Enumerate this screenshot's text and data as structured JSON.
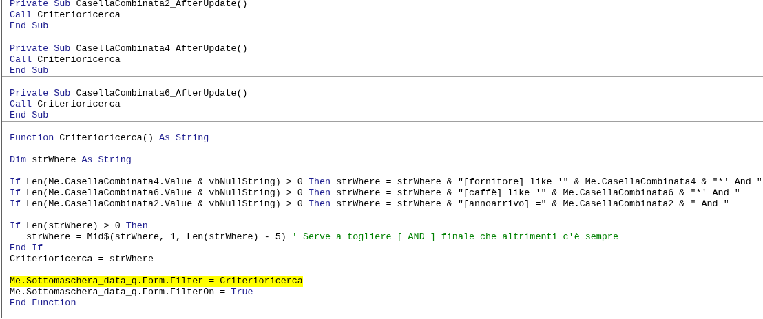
{
  "procedures": [
    {
      "lines": [
        {
          "kind": "code",
          "highlighted": false,
          "tokens": [
            {
              "kind": "keyword",
              "text": "Private Sub"
            },
            {
              "kind": "text",
              "text": " CasellaCombinata2_AfterUpdate()"
            }
          ]
        },
        {
          "kind": "code",
          "highlighted": false,
          "tokens": [
            {
              "kind": "keyword",
              "text": "Call"
            },
            {
              "kind": "text",
              "text": " Criterioricerca"
            }
          ]
        },
        {
          "kind": "code",
          "highlighted": false,
          "tokens": [
            {
              "kind": "keyword",
              "text": "End Sub"
            }
          ]
        }
      ]
    },
    {
      "lines": [
        {
          "kind": "blank"
        },
        {
          "kind": "code",
          "highlighted": false,
          "tokens": [
            {
              "kind": "keyword",
              "text": "Private Sub"
            },
            {
              "kind": "text",
              "text": " CasellaCombinata4_AfterUpdate()"
            }
          ]
        },
        {
          "kind": "code",
          "highlighted": false,
          "tokens": [
            {
              "kind": "keyword",
              "text": "Call"
            },
            {
              "kind": "text",
              "text": " Criterioricerca"
            }
          ]
        },
        {
          "kind": "code",
          "highlighted": false,
          "tokens": [
            {
              "kind": "keyword",
              "text": "End Sub"
            }
          ]
        }
      ]
    },
    {
      "lines": [
        {
          "kind": "blank"
        },
        {
          "kind": "code",
          "highlighted": false,
          "tokens": [
            {
              "kind": "keyword",
              "text": "Private Sub"
            },
            {
              "kind": "text",
              "text": " CasellaCombinata6_AfterUpdate()"
            }
          ]
        },
        {
          "kind": "code",
          "highlighted": false,
          "tokens": [
            {
              "kind": "keyword",
              "text": "Call"
            },
            {
              "kind": "text",
              "text": " Criterioricerca"
            }
          ]
        },
        {
          "kind": "code",
          "highlighted": false,
          "tokens": [
            {
              "kind": "keyword",
              "text": "End Sub"
            }
          ]
        }
      ]
    },
    {
      "lines": [
        {
          "kind": "blank"
        },
        {
          "kind": "code",
          "highlighted": false,
          "tokens": [
            {
              "kind": "keyword",
              "text": "Function"
            },
            {
              "kind": "text",
              "text": " Criterioricerca() "
            },
            {
              "kind": "keyword",
              "text": "As String"
            }
          ]
        },
        {
          "kind": "blank"
        },
        {
          "kind": "code",
          "highlighted": false,
          "tokens": [
            {
              "kind": "keyword",
              "text": "Dim"
            },
            {
              "kind": "text",
              "text": " strWhere "
            },
            {
              "kind": "keyword",
              "text": "As String"
            }
          ]
        },
        {
          "kind": "blank"
        },
        {
          "kind": "code",
          "highlighted": false,
          "tokens": [
            {
              "kind": "keyword",
              "text": "If"
            },
            {
              "kind": "text",
              "text": " Len(Me.CasellaCombinata4.Value & vbNullString) > 0 "
            },
            {
              "kind": "keyword",
              "text": "Then"
            },
            {
              "kind": "text",
              "text": " strWhere = strWhere & \"[fornitore] like '\" & Me.CasellaCombinata4 & \"*' And \""
            }
          ]
        },
        {
          "kind": "code",
          "highlighted": false,
          "tokens": [
            {
              "kind": "keyword",
              "text": "If"
            },
            {
              "kind": "text",
              "text": " Len(Me.CasellaCombinata6.Value & vbNullString) > 0 "
            },
            {
              "kind": "keyword",
              "text": "Then"
            },
            {
              "kind": "text",
              "text": " strWhere = strWhere & \"[caffè] like '\" & Me.CasellaCombinata6 & \"*' And \""
            }
          ]
        },
        {
          "kind": "code",
          "highlighted": false,
          "tokens": [
            {
              "kind": "keyword",
              "text": "If"
            },
            {
              "kind": "text",
              "text": " Len(Me.CasellaCombinata2.Value & vbNullString) > 0 "
            },
            {
              "kind": "keyword",
              "text": "Then"
            },
            {
              "kind": "text",
              "text": " strWhere = strWhere & \"[annoarrivo] =\" & Me.CasellaCombinata2 & \" And \""
            }
          ]
        },
        {
          "kind": "blank"
        },
        {
          "kind": "code",
          "highlighted": false,
          "tokens": [
            {
              "kind": "keyword",
              "text": "If"
            },
            {
              "kind": "text",
              "text": " Len(strWhere) > 0 "
            },
            {
              "kind": "keyword",
              "text": "Then"
            }
          ]
        },
        {
          "kind": "code",
          "highlighted": false,
          "tokens": [
            {
              "kind": "text",
              "text": "   strWhere = Mid$(strWhere, 1, Len(strWhere) - 5) "
            },
            {
              "kind": "comment",
              "text": "' Serve a togliere [ AND ] finale che altrimenti c'è sempre"
            }
          ]
        },
        {
          "kind": "code",
          "highlighted": false,
          "tokens": [
            {
              "kind": "keyword",
              "text": "End If"
            }
          ]
        },
        {
          "kind": "code",
          "highlighted": false,
          "tokens": [
            {
              "kind": "text",
              "text": "Criterioricerca = strWhere"
            }
          ]
        },
        {
          "kind": "blank"
        },
        {
          "kind": "code",
          "highlighted": true,
          "tokens": [
            {
              "kind": "text",
              "text": "Me.Sottomaschera_data_q.Form.Filter = Criterioricerca"
            }
          ]
        },
        {
          "kind": "code",
          "highlighted": false,
          "tokens": [
            {
              "kind": "text",
              "text": "Me.Sottomaschera_data_q.Form.FilterOn = "
            },
            {
              "kind": "keyword",
              "text": "True"
            }
          ]
        },
        {
          "kind": "code",
          "highlighted": false,
          "tokens": [
            {
              "kind": "keyword",
              "text": "End Function"
            }
          ]
        }
      ]
    }
  ]
}
